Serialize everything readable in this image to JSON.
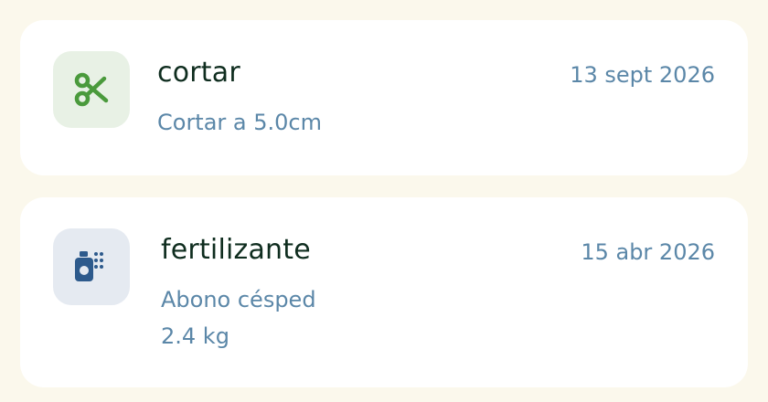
{
  "tasks": [
    {
      "icon": "scissors-icon",
      "icon_color": "#4a9a3c",
      "title": "cortar",
      "date": "13 sept 2026",
      "details": [
        "Cortar a 5.0cm"
      ]
    },
    {
      "icon": "fertilizer-spray-icon",
      "icon_color": "#2d5a8c",
      "title": "fertilizante",
      "date": "15 abr 2026",
      "details": [
        "Abono césped",
        "2.4 kg"
      ]
    }
  ],
  "colors": {
    "background": "#fbf8ec",
    "card": "#ffffff",
    "title": "#0f2d1f",
    "secondary": "#5b87a8"
  }
}
